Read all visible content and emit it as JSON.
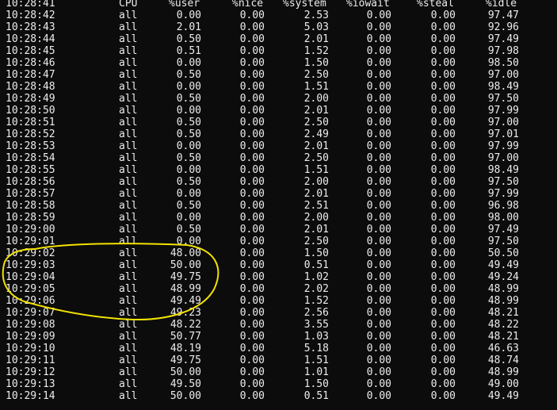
{
  "header": {
    "time": "10:28:41",
    "cpu": "CPU",
    "user": "%user",
    "nice": "%nice",
    "system": "%system",
    "iowait": "%iowait",
    "steal": "%steal",
    "idle": "%idle"
  },
  "rows": [
    {
      "time": "10:28:42",
      "cpu": "all",
      "user": "0.00",
      "nice": "0.00",
      "system": "2.53",
      "iowait": "0.00",
      "steal": "0.00",
      "idle": "97.47"
    },
    {
      "time": "10:28:43",
      "cpu": "all",
      "user": "2.01",
      "nice": "0.00",
      "system": "5.03",
      "iowait": "0.00",
      "steal": "0.00",
      "idle": "92.96"
    },
    {
      "time": "10:28:44",
      "cpu": "all",
      "user": "0.50",
      "nice": "0.00",
      "system": "2.01",
      "iowait": "0.00",
      "steal": "0.00",
      "idle": "97.49"
    },
    {
      "time": "10:28:45",
      "cpu": "all",
      "user": "0.51",
      "nice": "0.00",
      "system": "1.52",
      "iowait": "0.00",
      "steal": "0.00",
      "idle": "97.98"
    },
    {
      "time": "10:28:46",
      "cpu": "all",
      "user": "0.00",
      "nice": "0.00",
      "system": "1.50",
      "iowait": "0.00",
      "steal": "0.00",
      "idle": "98.50"
    },
    {
      "time": "10:28:47",
      "cpu": "all",
      "user": "0.50",
      "nice": "0.00",
      "system": "2.50",
      "iowait": "0.00",
      "steal": "0.00",
      "idle": "97.00"
    },
    {
      "time": "10:28:48",
      "cpu": "all",
      "user": "0.00",
      "nice": "0.00",
      "system": "1.51",
      "iowait": "0.00",
      "steal": "0.00",
      "idle": "98.49"
    },
    {
      "time": "10:28:49",
      "cpu": "all",
      "user": "0.50",
      "nice": "0.00",
      "system": "2.00",
      "iowait": "0.00",
      "steal": "0.00",
      "idle": "97.50"
    },
    {
      "time": "10:28:50",
      "cpu": "all",
      "user": "0.00",
      "nice": "0.00",
      "system": "2.01",
      "iowait": "0.00",
      "steal": "0.00",
      "idle": "97.99"
    },
    {
      "time": "10:28:51",
      "cpu": "all",
      "user": "0.50",
      "nice": "0.00",
      "system": "2.50",
      "iowait": "0.00",
      "steal": "0.00",
      "idle": "97.00"
    },
    {
      "time": "10:28:52",
      "cpu": "all",
      "user": "0.50",
      "nice": "0.00",
      "system": "2.49",
      "iowait": "0.00",
      "steal": "0.00",
      "idle": "97.01"
    },
    {
      "time": "10:28:53",
      "cpu": "all",
      "user": "0.00",
      "nice": "0.00",
      "system": "2.01",
      "iowait": "0.00",
      "steal": "0.00",
      "idle": "97.99"
    },
    {
      "time": "10:28:54",
      "cpu": "all",
      "user": "0.50",
      "nice": "0.00",
      "system": "2.50",
      "iowait": "0.00",
      "steal": "0.00",
      "idle": "97.00"
    },
    {
      "time": "10:28:55",
      "cpu": "all",
      "user": "0.00",
      "nice": "0.00",
      "system": "1.51",
      "iowait": "0.00",
      "steal": "0.00",
      "idle": "98.49"
    },
    {
      "time": "10:28:56",
      "cpu": "all",
      "user": "0.50",
      "nice": "0.00",
      "system": "2.00",
      "iowait": "0.00",
      "steal": "0.00",
      "idle": "97.50"
    },
    {
      "time": "10:28:57",
      "cpu": "all",
      "user": "0.00",
      "nice": "0.00",
      "system": "2.01",
      "iowait": "0.00",
      "steal": "0.00",
      "idle": "97.99"
    },
    {
      "time": "10:28:58",
      "cpu": "all",
      "user": "0.50",
      "nice": "0.00",
      "system": "2.51",
      "iowait": "0.00",
      "steal": "0.00",
      "idle": "96.98"
    },
    {
      "time": "10:28:59",
      "cpu": "all",
      "user": "0.00",
      "nice": "0.00",
      "system": "2.00",
      "iowait": "0.00",
      "steal": "0.00",
      "idle": "98.00"
    },
    {
      "time": "10:29:00",
      "cpu": "all",
      "user": "0.50",
      "nice": "0.00",
      "system": "2.01",
      "iowait": "0.00",
      "steal": "0.00",
      "idle": "97.49"
    },
    {
      "time": "10:29:01",
      "cpu": "all",
      "user": "0.00",
      "nice": "0.00",
      "system": "2.50",
      "iowait": "0.00",
      "steal": "0.00",
      "idle": "97.50"
    },
    {
      "time": "10:29:02",
      "cpu": "all",
      "user": "48.00",
      "nice": "0.00",
      "system": "1.50",
      "iowait": "0.00",
      "steal": "0.00",
      "idle": "50.50"
    },
    {
      "time": "10:29:03",
      "cpu": "all",
      "user": "50.00",
      "nice": "0.00",
      "system": "0.51",
      "iowait": "0.00",
      "steal": "0.00",
      "idle": "49.49"
    },
    {
      "time": "10:29:04",
      "cpu": "all",
      "user": "49.75",
      "nice": "0.00",
      "system": "1.02",
      "iowait": "0.00",
      "steal": "0.00",
      "idle": "49.24"
    },
    {
      "time": "10:29:05",
      "cpu": "all",
      "user": "48.99",
      "nice": "0.00",
      "system": "2.02",
      "iowait": "0.00",
      "steal": "0.00",
      "idle": "48.99"
    },
    {
      "time": "10:29:06",
      "cpu": "all",
      "user": "49.49",
      "nice": "0.00",
      "system": "1.52",
      "iowait": "0.00",
      "steal": "0.00",
      "idle": "48.99"
    },
    {
      "time": "10:29:07",
      "cpu": "all",
      "user": "49.23",
      "nice": "0.00",
      "system": "2.56",
      "iowait": "0.00",
      "steal": "0.00",
      "idle": "48.21"
    },
    {
      "time": "10:29:08",
      "cpu": "all",
      "user": "48.22",
      "nice": "0.00",
      "system": "3.55",
      "iowait": "0.00",
      "steal": "0.00",
      "idle": "48.22"
    },
    {
      "time": "10:29:09",
      "cpu": "all",
      "user": "50.77",
      "nice": "0.00",
      "system": "1.03",
      "iowait": "0.00",
      "steal": "0.00",
      "idle": "48.21"
    },
    {
      "time": "10:29:10",
      "cpu": "all",
      "user": "48.19",
      "nice": "0.00",
      "system": "5.18",
      "iowait": "0.00",
      "steal": "0.00",
      "idle": "46.63"
    },
    {
      "time": "10:29:11",
      "cpu": "all",
      "user": "49.75",
      "nice": "0.00",
      "system": "1.51",
      "iowait": "0.00",
      "steal": "0.00",
      "idle": "48.74"
    },
    {
      "time": "10:29:12",
      "cpu": "all",
      "user": "50.00",
      "nice": "0.00",
      "system": "1.01",
      "iowait": "0.00",
      "steal": "0.00",
      "idle": "48.99"
    },
    {
      "time": "10:29:13",
      "cpu": "all",
      "user": "49.50",
      "nice": "0.00",
      "system": "1.50",
      "iowait": "0.00",
      "steal": "0.00",
      "idle": "49.00"
    },
    {
      "time": "10:29:14",
      "cpu": "all",
      "user": "50.00",
      "nice": "0.00",
      "system": "0.51",
      "iowait": "0.00",
      "steal": "0.00",
      "idle": "49.49"
    }
  ],
  "annotation": {
    "color": "#f2e200"
  },
  "colors": {
    "background": "#0c0c0c",
    "text": "#ececec"
  }
}
